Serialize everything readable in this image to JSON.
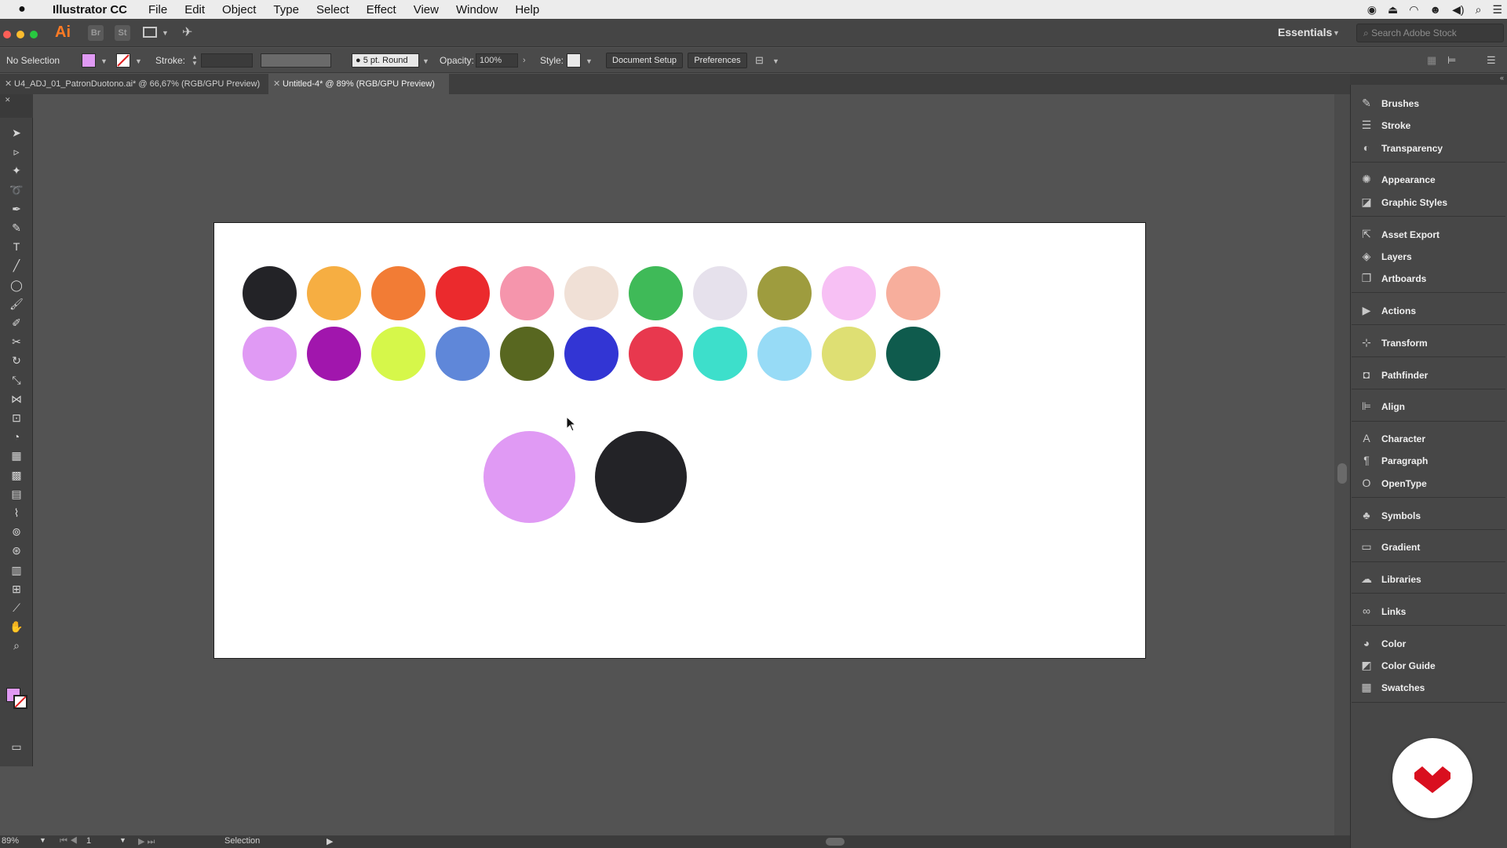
{
  "menubar": {
    "app_name": "Illustrator CC",
    "items": [
      "File",
      "Edit",
      "Object",
      "Type",
      "Select",
      "Effect",
      "View",
      "Window",
      "Help"
    ]
  },
  "appbar": {
    "logo": "Ai",
    "bridge_icon": "Br",
    "stock_icon": "St",
    "workspace": "Essentials",
    "stock_search_placeholder": "Search Adobe Stock"
  },
  "controlbar": {
    "selection_status": "No Selection",
    "fill_color": "#e09af4",
    "stroke_label": "Stroke:",
    "brush_label": "5 pt. Round",
    "opacity_label": "Opacity:",
    "opacity_value": "100%",
    "style_label": "Style:",
    "document_setup": "Document Setup",
    "preferences": "Preferences"
  },
  "tabs": [
    {
      "label": "U4_ADJ_01_PatronDuotono.ai* @ 66,67% (RGB/GPU Preview)",
      "active": false
    },
    {
      "label": "Untitled-4* @ 89% (RGB/GPU Preview)",
      "active": true
    }
  ],
  "tools": [
    {
      "name": "selection-tool-icon",
      "glyph": "➤"
    },
    {
      "name": "direct-selection-tool-icon",
      "glyph": "▹"
    },
    {
      "name": "magic-wand-tool-icon",
      "glyph": "✦"
    },
    {
      "name": "lasso-tool-icon",
      "glyph": "➰"
    },
    {
      "name": "pen-tool-icon",
      "glyph": "✒"
    },
    {
      "name": "curvature-tool-icon",
      "glyph": "✎"
    },
    {
      "name": "type-tool-icon",
      "glyph": "T"
    },
    {
      "name": "line-tool-icon",
      "glyph": "╱"
    },
    {
      "name": "ellipse-tool-icon",
      "glyph": "◯"
    },
    {
      "name": "paintbrush-tool-icon",
      "glyph": "🖌"
    },
    {
      "name": "blob-brush-tool-icon",
      "glyph": "✐"
    },
    {
      "name": "scissors-tool-icon",
      "glyph": "✂"
    },
    {
      "name": "rotate-tool-icon",
      "glyph": "↻"
    },
    {
      "name": "scale-tool-icon",
      "glyph": "⤡"
    },
    {
      "name": "width-tool-icon",
      "glyph": "⋈"
    },
    {
      "name": "free-transform-tool-icon",
      "glyph": "⊡"
    },
    {
      "name": "shape-builder-tool-icon",
      "glyph": "◔"
    },
    {
      "name": "perspective-grid-tool-icon",
      "glyph": "▦"
    },
    {
      "name": "mesh-tool-icon",
      "glyph": "▩"
    },
    {
      "name": "gradient-tool-icon",
      "glyph": "▤"
    },
    {
      "name": "eyedropper-tool-icon",
      "glyph": "⌇"
    },
    {
      "name": "blend-tool-icon",
      "glyph": "⊚"
    },
    {
      "name": "symbol-sprayer-tool-icon",
      "glyph": "⊛"
    },
    {
      "name": "column-graph-tool-icon",
      "glyph": "▥"
    },
    {
      "name": "artboard-tool-icon",
      "glyph": "⊞"
    },
    {
      "name": "slice-tool-icon",
      "glyph": "⟋"
    },
    {
      "name": "hand-tool-icon",
      "glyph": "✋"
    },
    {
      "name": "zoom-tool-icon",
      "glyph": "⌕"
    }
  ],
  "swatch_rows": [
    [
      "#232327",
      "#f6ae42",
      "#f27c35",
      "#eb2a2d",
      "#f595ac",
      "#f0e0d6",
      "#3fba58",
      "#e6e1ec",
      "#9e9c3e",
      "#f7c0f4",
      "#f7ae9c"
    ],
    [
      "#e09af4",
      "#a116ad",
      "#d6f74a",
      "#5f87d9",
      "#586720",
      "#3235d4",
      "#e8384e",
      "#3ddfcb",
      "#97dbf6",
      "#dedf73",
      "#0f5b4d"
    ]
  ],
  "large_swatches": [
    "#e09af4",
    "#232327"
  ],
  "panels": [
    {
      "name": "panel-brushes",
      "icon": "brush-icon",
      "glyph": "✎",
      "label": "Brushes"
    },
    {
      "name": "panel-stroke",
      "icon": "stroke-icon",
      "glyph": "☰",
      "label": "Stroke"
    },
    {
      "name": "panel-transparency",
      "icon": "transparency-icon",
      "glyph": "◐",
      "label": "Transparency"
    },
    {
      "name": "panel-appearance",
      "icon": "appearance-icon",
      "glyph": "✺",
      "label": "Appearance"
    },
    {
      "name": "panel-graphic-styles",
      "icon": "graphic-styles-icon",
      "glyph": "◪",
      "label": "Graphic Styles"
    },
    {
      "name": "panel-asset-export",
      "icon": "asset-export-icon",
      "glyph": "⇱",
      "label": "Asset Export"
    },
    {
      "name": "panel-layers",
      "icon": "layers-icon",
      "glyph": "◈",
      "label": "Layers"
    },
    {
      "name": "panel-artboards",
      "icon": "artboards-icon",
      "glyph": "❐",
      "label": "Artboards"
    },
    {
      "name": "panel-actions",
      "icon": "actions-icon",
      "glyph": "▶",
      "label": "Actions"
    },
    {
      "name": "panel-transform",
      "icon": "transform-icon",
      "glyph": "⊹",
      "label": "Transform"
    },
    {
      "name": "panel-pathfinder",
      "icon": "pathfinder-icon",
      "glyph": "◘",
      "label": "Pathfinder"
    },
    {
      "name": "panel-align",
      "icon": "align-icon",
      "glyph": "⊫",
      "label": "Align"
    },
    {
      "name": "panel-character",
      "icon": "character-icon",
      "glyph": "A",
      "label": "Character"
    },
    {
      "name": "panel-paragraph",
      "icon": "paragraph-icon",
      "glyph": "¶",
      "label": "Paragraph"
    },
    {
      "name": "panel-opentype",
      "icon": "opentype-icon",
      "glyph": "O",
      "label": "OpenType"
    },
    {
      "name": "panel-symbols",
      "icon": "symbols-icon",
      "glyph": "♣",
      "label": "Symbols"
    },
    {
      "name": "panel-gradient",
      "icon": "gradient-icon",
      "glyph": "▭",
      "label": "Gradient"
    },
    {
      "name": "panel-libraries",
      "icon": "libraries-icon",
      "glyph": "☁",
      "label": "Libraries"
    },
    {
      "name": "panel-links",
      "icon": "links-icon",
      "glyph": "∞",
      "label": "Links"
    },
    {
      "name": "panel-color",
      "icon": "color-icon",
      "glyph": "◕",
      "label": "Color"
    },
    {
      "name": "panel-color-guide",
      "icon": "color-guide-icon",
      "glyph": "◩",
      "label": "Color Guide"
    },
    {
      "name": "panel-swatches",
      "icon": "swatches-icon",
      "glyph": "▦",
      "label": "Swatches"
    }
  ],
  "statusbar": {
    "zoom": "89%",
    "artboard_number": "1",
    "tool_status": "Selection"
  },
  "brand_color": "#d90f1f"
}
